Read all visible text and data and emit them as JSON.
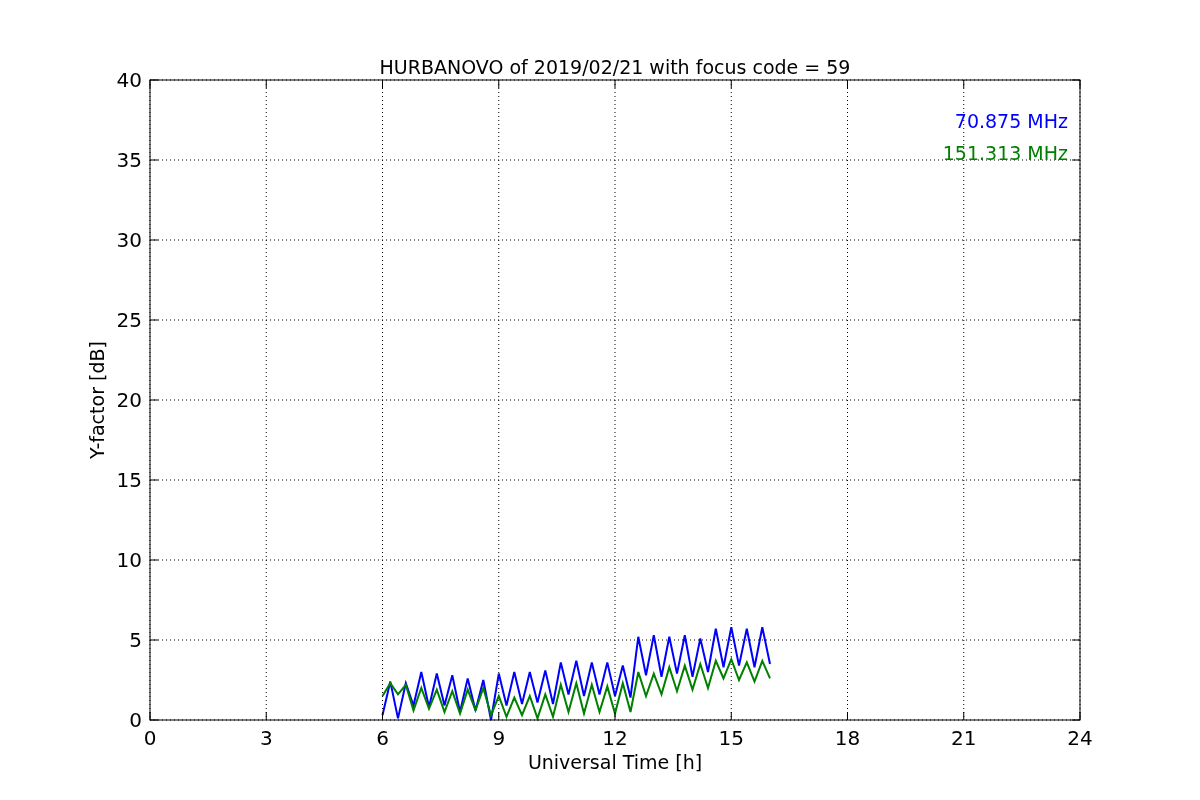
{
  "chart_data": {
    "type": "line",
    "title": "HURBANOVO of 2019/02/21 with focus code = 59",
    "xlabel": "Universal Time [h]",
    "ylabel": "Y-factor [dB]",
    "x": [
      6.0,
      6.2,
      6.4,
      6.6,
      6.8,
      7.0,
      7.2,
      7.4,
      7.6,
      7.8,
      8.0,
      8.2,
      8.4,
      8.6,
      8.8,
      9.0,
      9.2,
      9.4,
      9.6,
      9.8,
      10.0,
      10.2,
      10.4,
      10.6,
      10.8,
      11.0,
      11.2,
      11.4,
      11.6,
      11.8,
      12.0,
      12.2,
      12.4,
      12.6,
      12.8,
      13.0,
      13.2,
      13.4,
      13.6,
      13.8,
      14.0,
      14.2,
      14.4,
      14.6,
      14.8,
      15.0,
      15.2,
      15.4,
      15.6,
      15.8,
      16.0
    ],
    "series": [
      {
        "name": "70.875 MHz",
        "color": "#0000ff",
        "values": [
          0.3,
          2.4,
          0.1,
          2.3,
          0.9,
          3.0,
          0.8,
          2.9,
          0.9,
          2.8,
          0.5,
          2.6,
          0.6,
          2.5,
          0.0,
          2.9,
          0.9,
          3.0,
          1.0,
          3.0,
          1.1,
          3.1,
          1.0,
          3.6,
          1.6,
          3.7,
          1.5,
          3.6,
          1.6,
          3.6,
          1.5,
          3.4,
          1.4,
          5.2,
          2.8,
          5.3,
          2.7,
          5.2,
          2.9,
          5.3,
          2.7,
          5.1,
          3.0,
          5.7,
          3.3,
          5.8,
          3.4,
          5.7,
          3.3,
          5.8,
          3.5
        ]
      },
      {
        "name": "151.313 MHz",
        "color": "#008000",
        "values": [
          1.5,
          2.3,
          1.6,
          2.2,
          0.6,
          2.0,
          0.7,
          1.9,
          0.5,
          1.8,
          0.4,
          1.9,
          0.6,
          2.0,
          0.3,
          1.5,
          0.2,
          1.4,
          0.3,
          1.5,
          0.1,
          1.6,
          0.2,
          2.2,
          0.5,
          2.3,
          0.4,
          2.2,
          0.5,
          2.1,
          0.4,
          2.3,
          0.5,
          3.0,
          1.5,
          2.9,
          1.6,
          3.3,
          1.8,
          3.4,
          1.9,
          3.5,
          2.0,
          3.7,
          2.6,
          3.8,
          2.5,
          3.6,
          2.4,
          3.7,
          2.6
        ]
      }
    ],
    "grid": true,
    "xlim": [
      0,
      24
    ],
    "ylim": [
      0,
      40
    ],
    "xticks": [
      0,
      3,
      6,
      9,
      12,
      15,
      18,
      21,
      24
    ],
    "yticks": [
      0,
      5,
      10,
      15,
      20,
      25,
      30,
      35,
      40
    ]
  }
}
